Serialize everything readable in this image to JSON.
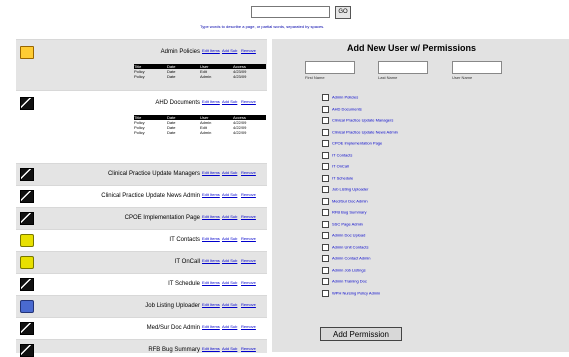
{
  "search": {
    "button_label": "GO",
    "hint": "Type words to describe a page, or partial words, separated by spaces."
  },
  "items": [
    {
      "name": "Admin Policies",
      "icon": "folder-icon",
      "shade": true,
      "edit": "Edit Items",
      "mod": "Add Sub",
      "rem": "Remove",
      "sub": {
        "headers": [
          "Title",
          "Date",
          "User",
          "Access"
        ],
        "rows": [
          [
            "Policy",
            "Date",
            "Edit",
            "4/23/09"
          ],
          [
            "Policy",
            "Date",
            "Admin",
            "4/23/09"
          ]
        ]
      }
    },
    {
      "name": "AHD Documents",
      "icon": "doc-icon",
      "shade": false,
      "edit": "Edit Items",
      "mod": "Add Sub",
      "rem": "Remove",
      "sub": {
        "headers": [
          "Title",
          "Date",
          "User",
          "Access"
        ],
        "rows": [
          [
            "Policy",
            "Date",
            "Admin",
            "4/22/09"
          ],
          [
            "Policy",
            "Date",
            "Edit",
            "4/22/09"
          ],
          [
            "Policy",
            "Date",
            "Admin",
            "4/22/09"
          ]
        ]
      }
    },
    {
      "name": "Clinical Practice Update Managers",
      "icon": "doc-icon",
      "shade": true,
      "edit": "Edit Items",
      "mod": "Add Sub",
      "rem": "Remove"
    },
    {
      "name": "Clinical Practice Update News Admin",
      "icon": "doc-icon",
      "shade": false,
      "edit": "Edit Items",
      "mod": "Add Sub",
      "rem": "Remove"
    },
    {
      "name": "CPOE Implementation Page",
      "icon": "doc-icon",
      "shade": true,
      "edit": "Edit Items",
      "mod": "Add Sub",
      "rem": "Remove"
    },
    {
      "name": "IT Contacts",
      "icon": "stack-icon",
      "shade": false,
      "edit": "Edit Items",
      "mod": "Add Sub",
      "rem": "Remove"
    },
    {
      "name": "IT OnCall",
      "icon": "stack-icon",
      "shade": true,
      "edit": "Edit Items",
      "mod": "Add Sub",
      "rem": "Remove"
    },
    {
      "name": "IT Schedule",
      "icon": "doc-icon",
      "shade": false,
      "edit": "Edit Items",
      "mod": "Add Sub",
      "rem": "Remove"
    },
    {
      "name": "Job Listing Uploader",
      "icon": "network-icon",
      "shade": true,
      "edit": "Edit Items",
      "mod": "Add Sub",
      "rem": "Remove"
    },
    {
      "name": "Med/Sur Doc Admin",
      "icon": "doc-icon",
      "shade": false,
      "edit": "Edit Items",
      "mod": "Add Sub",
      "rem": "Remove"
    },
    {
      "name": "RFB Bug Summary",
      "icon": "doc-icon",
      "shade": true,
      "edit": "Edit Items",
      "mod": "Add Sub",
      "rem": "Remove"
    }
  ],
  "panel": {
    "title": "Add New User w/ Permissions",
    "first": "First Name",
    "last": "Last Name",
    "user": "User Name",
    "perms": [
      "Admin Policies",
      "AHD Documents",
      "Clinical Practice Update Managers",
      "Clinical Practice Update News Admin",
      "CPOE Implementation Page",
      "IT Contacts",
      "IT OnCall",
      "IT Schedule",
      "Job Listing Uploader",
      "Med/Sur Doc Admin",
      "RFB Bug Summary",
      "SSC Page Admin",
      "Admin Doc Upload",
      "Admin Unit Contacts",
      "Admin Contact Admin",
      "Admin Job Listings",
      "Admin Training Doc",
      "WPH Nursing Policy Admin"
    ],
    "button": "Add Permission"
  }
}
